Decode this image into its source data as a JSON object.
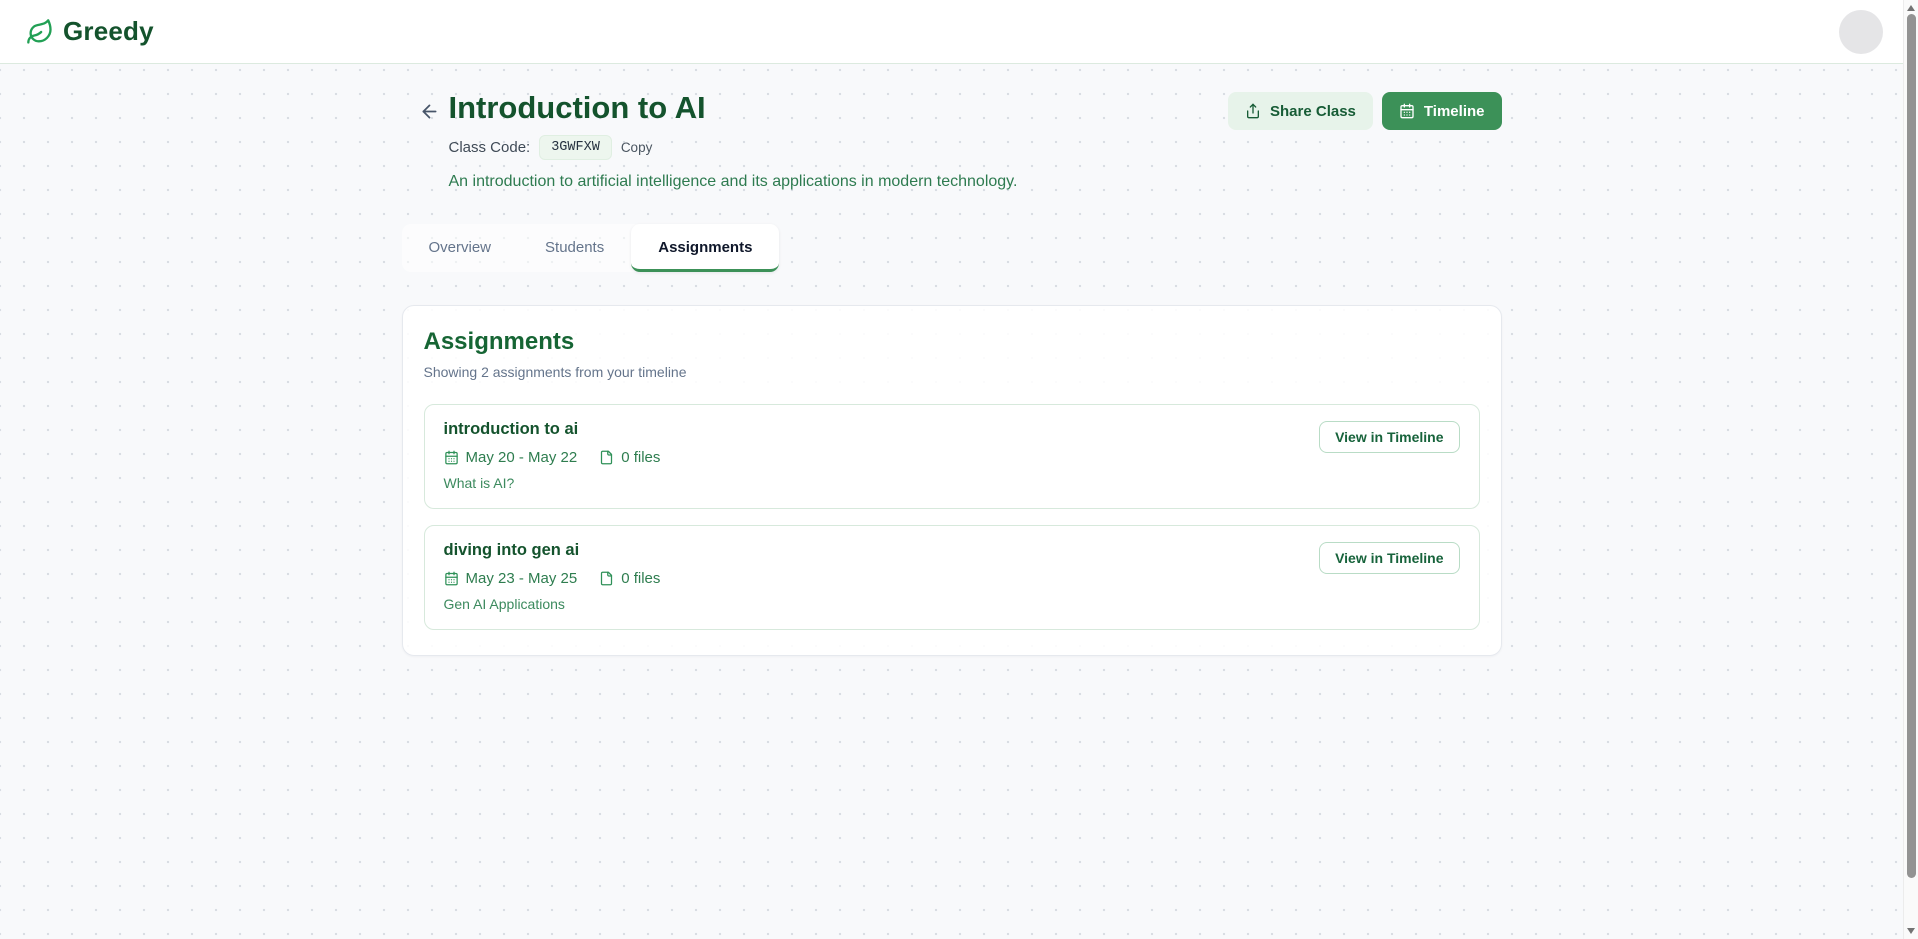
{
  "colors": {
    "brand_dark_green": "#14532d",
    "accent_green": "#3c9158",
    "light_green_bg": "#e7f3ea",
    "meta_green": "#2e7d4f",
    "page_bg": "#f8f9fb"
  },
  "navbar": {
    "brand": "Greedy",
    "logo_icon": "leaf-icon"
  },
  "header": {
    "title": "Introduction to AI",
    "class_code_label": "Class Code:",
    "class_code": "3GWFXW",
    "copy_label": "Copy",
    "description": "An introduction to artificial intelligence and its applications in modern technology.",
    "share_button": "Share Class",
    "timeline_button": "Timeline"
  },
  "tabs": [
    {
      "label": "Overview",
      "active": false
    },
    {
      "label": "Students",
      "active": false
    },
    {
      "label": "Assignments",
      "active": true
    }
  ],
  "panel": {
    "title": "Assignments",
    "subtitle": "Showing 2 assignments from your timeline",
    "items": [
      {
        "title": "introduction to ai",
        "dates": "May 20 - May 22",
        "files": "0 files",
        "description": "What is AI?",
        "action": "View in Timeline"
      },
      {
        "title": "diving into gen ai",
        "dates": "May 23 - May 25",
        "files": "0 files",
        "description": "Gen AI Applications",
        "action": "View in Timeline"
      }
    ]
  }
}
